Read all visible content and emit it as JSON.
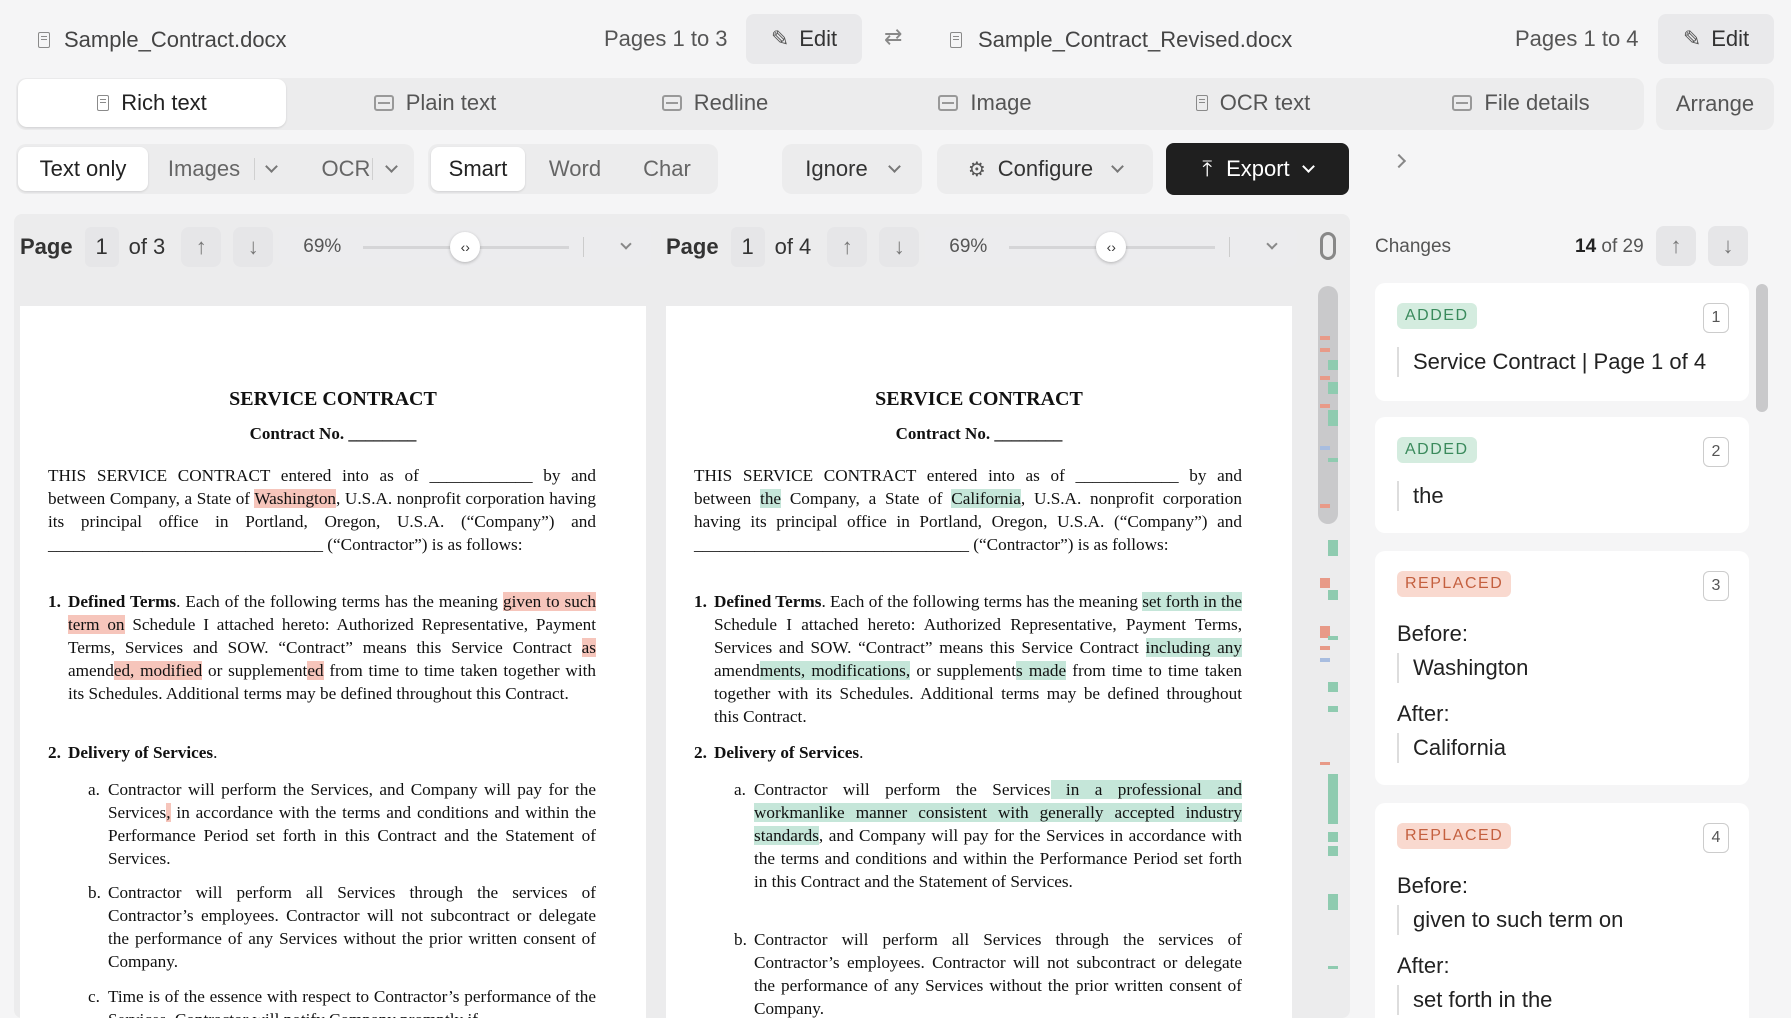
{
  "header": {
    "left_file": "Sample_Contract.docx",
    "left_pages": "Pages 1 to 3",
    "edit_label": "Edit",
    "right_file": "Sample_Contract_Revised.docx",
    "right_pages": "Pages 1 to 4"
  },
  "tabs": [
    "Rich text",
    "Plain text",
    "Redline",
    "Image",
    "OCR text",
    "File details"
  ],
  "arrange_label": "Arrange",
  "toolbar": {
    "text_only": "Text only",
    "images": "Images",
    "ocr": "OCR",
    "smart": "Smart",
    "word": "Word",
    "char": "Char",
    "ignore": "Ignore",
    "configure": "Configure",
    "export": "Export"
  },
  "left_pane": {
    "page_label": "Page",
    "page_num": "1",
    "of": "of 3",
    "zoom": "69%"
  },
  "right_pane": {
    "page_label": "Page",
    "page_num": "1",
    "of": "of 4",
    "zoom": "69%"
  },
  "changes": {
    "title": "Changes",
    "current": "14",
    "of_total": "of 29",
    "items": [
      {
        "type": "ADDED",
        "num": "1",
        "text": "Service Contract | Page 1 of 4"
      },
      {
        "type": "ADDED",
        "num": "2",
        "text": "the"
      },
      {
        "type": "REPLACED",
        "num": "3",
        "before_label": "Before:",
        "before": "Washington",
        "after_label": "After:",
        "after": "California"
      },
      {
        "type": "REPLACED",
        "num": "4",
        "before_label": "Before:",
        "before": "given to such term on",
        "after_label": "After:",
        "after": "set forth in the"
      }
    ]
  },
  "left_doc": {
    "title": "SERVICE CONTRACT",
    "contract_no": "Contract No. ________",
    "p1a": "THIS SERVICE CONTRACT entered into as of ____________ by and between Company, a State of ",
    "p1b": "Washington",
    "p1c": ", U.S.A. nonprofit corporation having its principal office in Portland, Oregon, U.S.A. (“Company”) and ________________________________ (“Contractor”) is as follows:",
    "s1_num": "1.",
    "s1_head": "Defined Terms",
    "s1a": ". Each of the following terms has the meaning ",
    "s1b": "given to such term on",
    "s1c": " Schedule I attached hereto: Authorized Representative, Payment Terms, Services and SOW. “Contract” means this Service Contract ",
    "s1d": "as",
    "s1e": " amend",
    "s1f": "ed, modified",
    "s1g": " or supplement",
    "s1h": "ed",
    "s1i": " from time to time taken together with its Schedules. Additional terms may be defined throughout this Contract.",
    "s2_num": "2.",
    "s2_head": "Delivery of Services",
    "a_label": "a.",
    "a1": "Contractor will perform the Services, and Company will pay for the Services",
    "a2": ",",
    "a3": " in accordance with the terms and conditions and within the Performance Period set forth in this Contract and the Statement of Services.",
    "b_label": "b.",
    "b1": "Contractor will perform all Services through the services of Contractor’s employees. Contractor will not subcontract or delegate the performance of any Services without the prior written consent of Company.",
    "c_label": "c.",
    "c1": "Time is of the essence with respect to Contractor’s performance of the Services. Contractor will notify Company promptly if"
  },
  "right_doc": {
    "title": "SERVICE CONTRACT",
    "contract_no": "Contract No. ________",
    "p1a": "THIS SERVICE CONTRACT entered into as of ____________ by and between ",
    "p1b": "the",
    "p1c": " Company, a State of ",
    "p1d": "California",
    "p1e": ", U.S.A. nonprofit corporation having its principal office in Portland, Oregon, U.S.A. (“Company”) and ________________________________ (“Contractor”) is as follows:",
    "s1_num": "1.",
    "s1_head": "Defined Terms",
    "s1a": ". Each of the following terms has the meaning ",
    "s1b": "set forth in the",
    "s1c": " Schedule I attached hereto: Authorized Representative, Payment Terms, Services and SOW. “Contract” means this Service Contract ",
    "s1d": "including any",
    "s1e": " amend",
    "s1f": "ments, modifications,",
    "s1g": " or supplement",
    "s1h": "s made",
    "s1i": " from time to time taken together with its Schedules. Additional terms may be defined throughout this Contract.",
    "s2_num": "2.",
    "s2_head": "Delivery of Services",
    "a_label": "a.",
    "a1": "Contractor will perform the Services",
    "a2": " in a professional and workmanlike manner consistent with generally accepted industry standards",
    "a3": ", and Company will pay for the Services in accordance with the terms and conditions and within the Performance Period set forth in this Contract and the Statement of Services.",
    "b_label": "b.",
    "b1": "Contractor will perform all Services through the services of Contractor’s employees. Contractor will not subcontract or delegate the performance of any Services without the prior written consent of Company."
  },
  "colors": {
    "deleted": "#f6c5bb",
    "inserted": "#c5e6d9",
    "export_bg": "#1f1f1f"
  }
}
